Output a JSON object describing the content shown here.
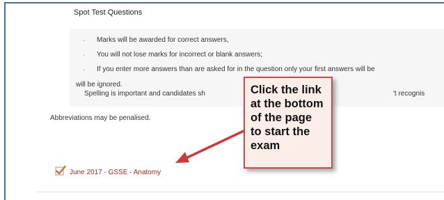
{
  "heading": "Spot Test Questions",
  "rules": {
    "items": [
      "Marks will be awarded for correct answers,",
      "You will not lose marks for incorrect or blank answers;",
      "If you enter more answers than are asked for in the question only your first answers will be"
    ],
    "continuation": "will be ignored.",
    "spelling_start": "Spelling is important and candidates sh",
    "spelling_end": "'t recognis"
  },
  "abbreviations": "Abbreviations may be penalised.",
  "exam_link": {
    "label": "June 2017 - GSSE - Anatomy",
    "icon": "checkbox-check-icon"
  },
  "callout": {
    "text": "Click the link at the bottom of the page to start the exam"
  },
  "colors": {
    "frame": "#3f6fb5",
    "link": "#b0281e",
    "callout_border": "#c94a48",
    "callout_fill": "#fbeee9",
    "arrow": "#d0393a"
  }
}
